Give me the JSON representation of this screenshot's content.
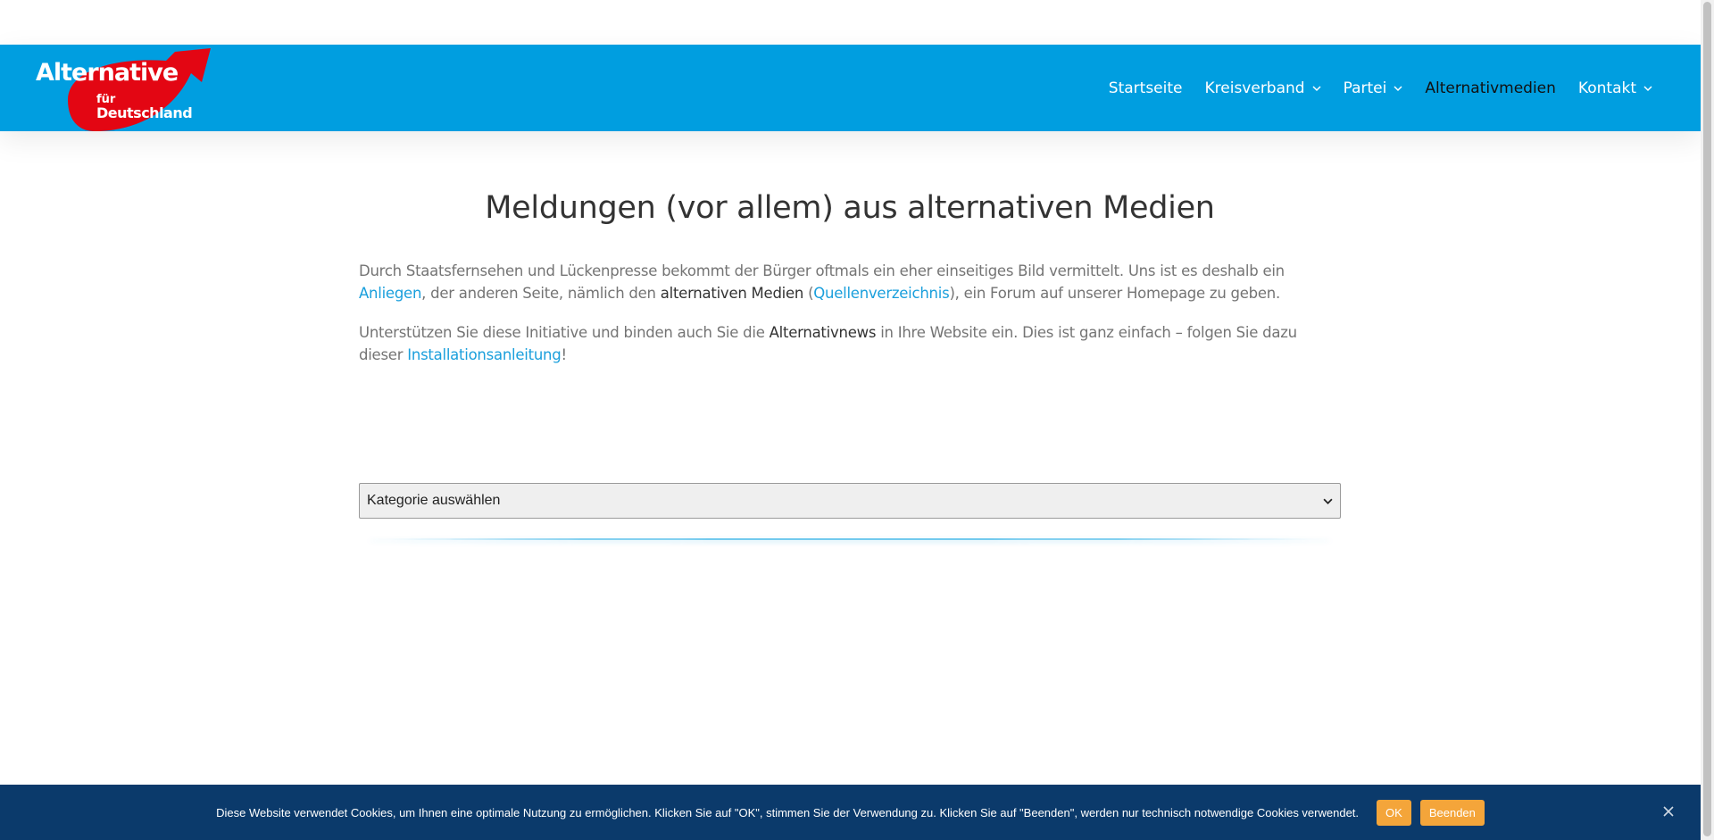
{
  "header": {
    "logo": {
      "line1": "Alternative",
      "line2": "für",
      "line3": "Deutschland",
      "colors": {
        "arrow": "#e30613",
        "text": "#ffffff"
      }
    },
    "nav": [
      {
        "label": "Startseite",
        "dropdown": false,
        "active": false
      },
      {
        "label": "Kreisverband",
        "dropdown": true,
        "active": false
      },
      {
        "label": "Partei",
        "dropdown": true,
        "active": false
      },
      {
        "label": "Alternativmedien",
        "dropdown": false,
        "active": true
      },
      {
        "label": "Kontakt",
        "dropdown": true,
        "active": false
      }
    ],
    "background": "#009ee0"
  },
  "main": {
    "title": "Meldungen (vor allem) aus alternativen Medien",
    "para1": {
      "t1": "Durch Staatsfernsehen und Lückenpresse bekommt der Bürger oftmals ein eher einseitiges Bild vermittelt. Uns ist es deshalb ein ",
      "link1": "Anliegen",
      "t2": ", der anderen Seite, nämlich den ",
      "strong1": "alternativen Medien",
      "t3": " (",
      "link2": "Quellenverzeichnis",
      "t4": "), ein Forum auf unserer Homepage zu geben."
    },
    "para2": {
      "t1": "Unterstützen Sie diese Initiative und binden auch Sie die ",
      "strong1": "Alternativnews",
      "t2": " in Ihre Website ein. Dies ist ganz einfach – folgen Sie dazu dieser ",
      "link1": "Installationsanleitung",
      "t3": "!"
    },
    "category_select": {
      "selected": "Kategorie auswählen"
    }
  },
  "cookie": {
    "text": "Diese Website verwendet Cookies, um Ihnen eine optimale Nutzung zu ermöglichen. Klicken Sie auf \"OK\", stimmen Sie der Verwendung zu. Klicken Sie auf \"Beenden\", werden nur technisch notwendige Cookies verwendet.",
    "ok_label": "OK",
    "end_label": "Beenden",
    "colors": {
      "bar": "#0b3a6b",
      "button": "#f4a53a"
    }
  }
}
